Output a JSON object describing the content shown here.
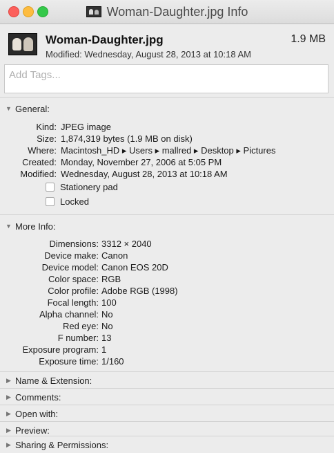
{
  "window": {
    "title": "Woman-Daughter.jpg Info"
  },
  "header": {
    "file_name": "Woman-Daughter.jpg",
    "file_size": "1.9 MB",
    "modified": "Modified: Wednesday, August 28, 2013 at 10:18 AM"
  },
  "tags": {
    "placeholder": "Add Tags..."
  },
  "general": {
    "title": "General:",
    "rows": [
      {
        "label": "Kind:",
        "value": "JPEG image"
      },
      {
        "label": "Size:",
        "value": "1,874,319 bytes (1.9 MB on disk)"
      },
      {
        "label": "Where:",
        "value": "Macintosh_HD ▸ Users ▸ mallred ▸ Desktop ▸ Pictures"
      },
      {
        "label": "Created:",
        "value": "Monday, November 27, 2006 at 5:05 PM"
      },
      {
        "label": "Modified:",
        "value": "Wednesday, August 28, 2013 at 10:18 AM"
      }
    ],
    "stationery_label": "Stationery pad",
    "locked_label": "Locked"
  },
  "more_info": {
    "title": "More Info:",
    "rows": [
      {
        "label": "Dimensions:",
        "value": "3312 × 2040"
      },
      {
        "label": "Device make:",
        "value": "Canon"
      },
      {
        "label": "Device model:",
        "value": "Canon EOS 20D"
      },
      {
        "label": "Color space:",
        "value": "RGB"
      },
      {
        "label": "Color profile:",
        "value": "Adobe RGB (1998)"
      },
      {
        "label": "Focal length:",
        "value": "100"
      },
      {
        "label": "Alpha channel:",
        "value": "No"
      },
      {
        "label": "Red eye:",
        "value": "No"
      },
      {
        "label": "F number:",
        "value": "13"
      },
      {
        "label": "Exposure program:",
        "value": "1"
      },
      {
        "label": "Exposure time:",
        "value": "1/160"
      }
    ]
  },
  "collapsed_sections": [
    "Name & Extension:",
    "Comments:",
    "Open with:",
    "Preview:",
    "Sharing & Permissions:"
  ]
}
